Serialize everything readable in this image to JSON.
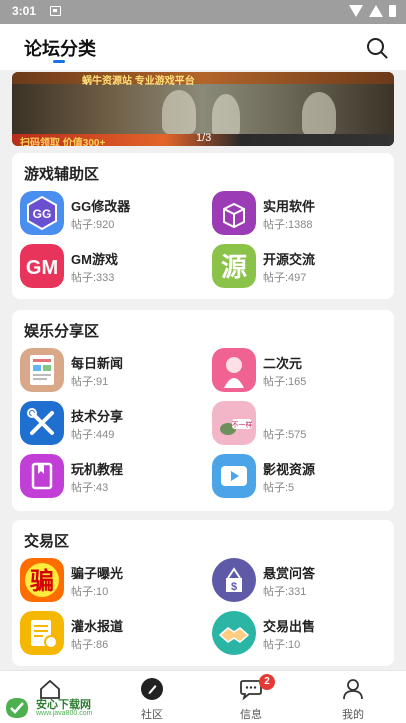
{
  "status_bar": {
    "time": "3:01"
  },
  "header": {
    "title": "论坛分类"
  },
  "banner": {
    "top_text": "蜗牛资源站 专业游戏平台",
    "bottom_text": "扫码领取 价值300+",
    "counter": "1/3"
  },
  "sections": [
    {
      "title": "游戏辅助区",
      "items": [
        {
          "name": "GG修改器",
          "count": "帖子:920",
          "icon": "gg-icon"
        },
        {
          "name": "实用软件",
          "count": "帖子:1388",
          "icon": "box-icon"
        },
        {
          "name": "GM游戏",
          "count": "帖子:333",
          "icon": "gm-icon"
        },
        {
          "name": "开源交流",
          "count": "帖子:497",
          "icon": "source-icon"
        }
      ]
    },
    {
      "title": "娱乐分享区",
      "items": [
        {
          "name": "每日新闻",
          "count": "帖子:91",
          "icon": "news-icon"
        },
        {
          "name": "二次元",
          "count": "帖子:165",
          "icon": "anime-icon"
        },
        {
          "name": "技术分享",
          "count": "帖子:449",
          "icon": "tools-icon"
        },
        {
          "name": "",
          "count": "帖子:575",
          "icon": "meme-icon"
        },
        {
          "name": "玩机教程",
          "count": "帖子:43",
          "icon": "book-icon"
        },
        {
          "name": "影视资源",
          "count": "帖子:5",
          "icon": "video-icon"
        }
      ]
    },
    {
      "title": "交易区",
      "items": [
        {
          "name": "骗子曝光",
          "count": "帖子:10",
          "icon": "scam-icon"
        },
        {
          "name": "悬赏问答",
          "count": "帖子:331",
          "icon": "bounty-icon"
        },
        {
          "name": "灌水报道",
          "count": "帖子:86",
          "icon": "notes-icon"
        },
        {
          "name": "交易出售",
          "count": "帖子:10",
          "icon": "handshake-icon"
        }
      ]
    }
  ],
  "bottom_nav": {
    "tabs": [
      {
        "label": "",
        "icon": "home-icon"
      },
      {
        "label": "社区",
        "icon": "community-icon"
      },
      {
        "label": "信息",
        "icon": "message-icon",
        "badge": "2"
      },
      {
        "label": "我的",
        "icon": "profile-icon"
      }
    ]
  },
  "watermark": {
    "text": "安心下载网",
    "url": "www.java800.com"
  },
  "colors": {
    "accent": "#1a73e8",
    "badge": "#e53935"
  }
}
